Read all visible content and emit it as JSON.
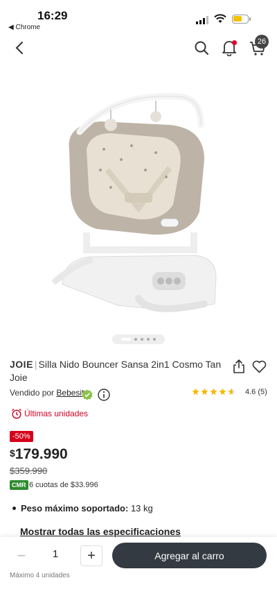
{
  "status_bar": {
    "time": "16:29",
    "back_app": "◀ Chrome"
  },
  "header": {
    "cart_count": "26"
  },
  "product": {
    "brand": "JOIE",
    "title": "Silla Nido Bouncer Sansa 2in1 Cosmo Tan Joie",
    "seller_prefix": "Vendido por",
    "seller_name": "Bebesit",
    "rating_value": 4.6,
    "rating_text": "4.6 (5)",
    "urgency": "Últimas unidades",
    "discount": "-50%",
    "price_currency": "$",
    "price": "179.990",
    "old_price": "$359.990",
    "cmr_label": "CMR",
    "installments": "6 cuotas de $33.996",
    "spec_label": "Peso máximo soportado:",
    "spec_value": "13 kg",
    "show_specs": "Mostrar todas las especificaciones"
  },
  "carousel": {
    "count": 5,
    "active_index": 0
  },
  "purchase": {
    "quantity": "1",
    "add_to_cart_label": "Agregar al carro",
    "max_units": "Máximo 4 unidades"
  },
  "colors": {
    "accent_red": "#d6001c",
    "cmr_green": "#2e8b2e",
    "cta_dark": "#333a41",
    "star": "#f5b800"
  }
}
